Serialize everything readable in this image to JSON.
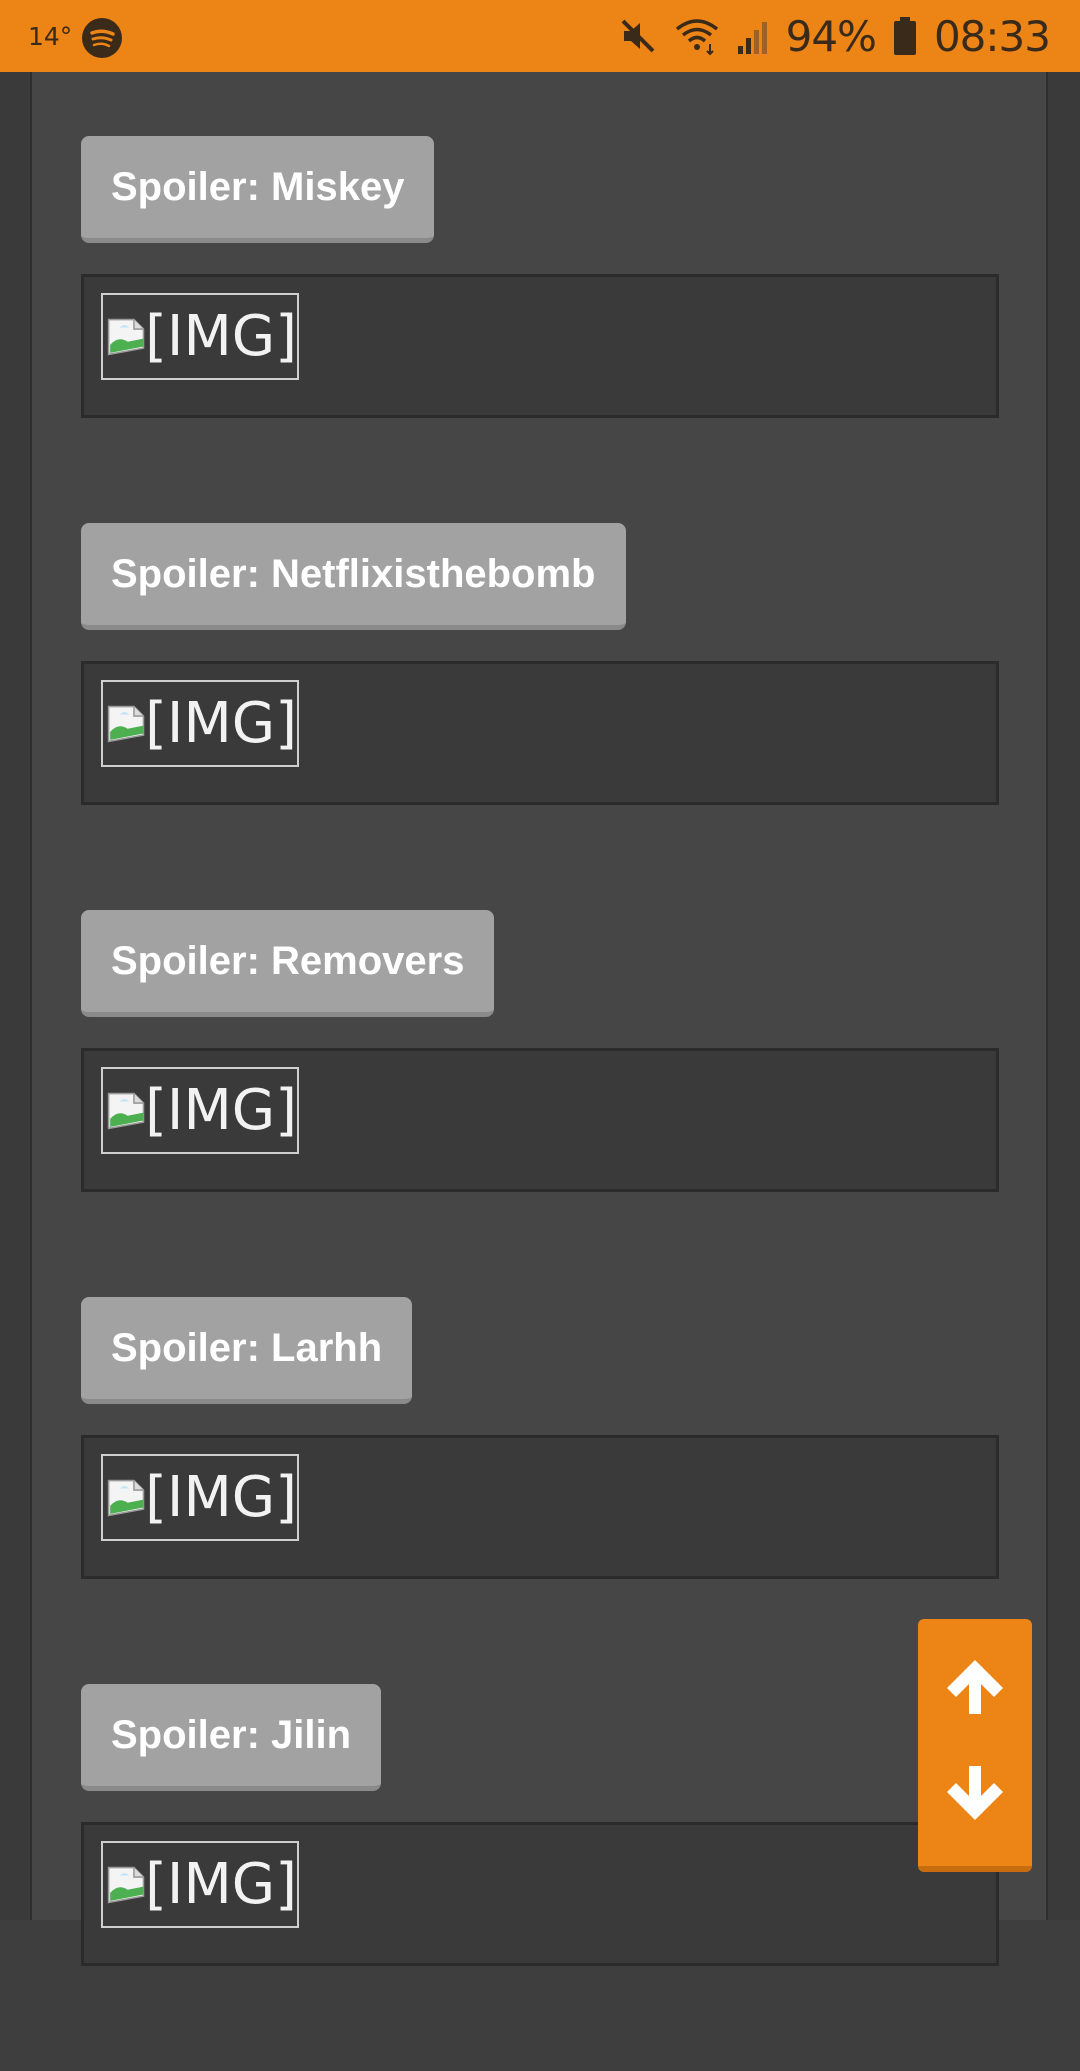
{
  "status_bar": {
    "temperature": "14°",
    "battery_percent": "94%",
    "time": "08:33",
    "icons": [
      "spotify-icon",
      "mute-icon",
      "wifi-icon",
      "signal-icon",
      "battery-icon"
    ]
  },
  "spoilers": [
    {
      "label": "Spoiler: Miskey",
      "content_alt": "[IMG]"
    },
    {
      "label": "Spoiler: Netflixisthebomb",
      "content_alt": "[IMG]"
    },
    {
      "label": "Spoiler: Removers",
      "content_alt": "[IMG]"
    },
    {
      "label": "Spoiler: Larhh",
      "content_alt": "[IMG]"
    },
    {
      "label": "Spoiler: Jilin",
      "content_alt": "[IMG]"
    }
  ],
  "scroll_nav": {
    "up_icon": "arrow-up-icon",
    "down_icon": "arrow-down-icon"
  },
  "colors": {
    "accent": "#ec8416",
    "page_bg": "#464646",
    "spoiler_button": "#a2a2a2",
    "content_box": "#3a3a3a"
  }
}
